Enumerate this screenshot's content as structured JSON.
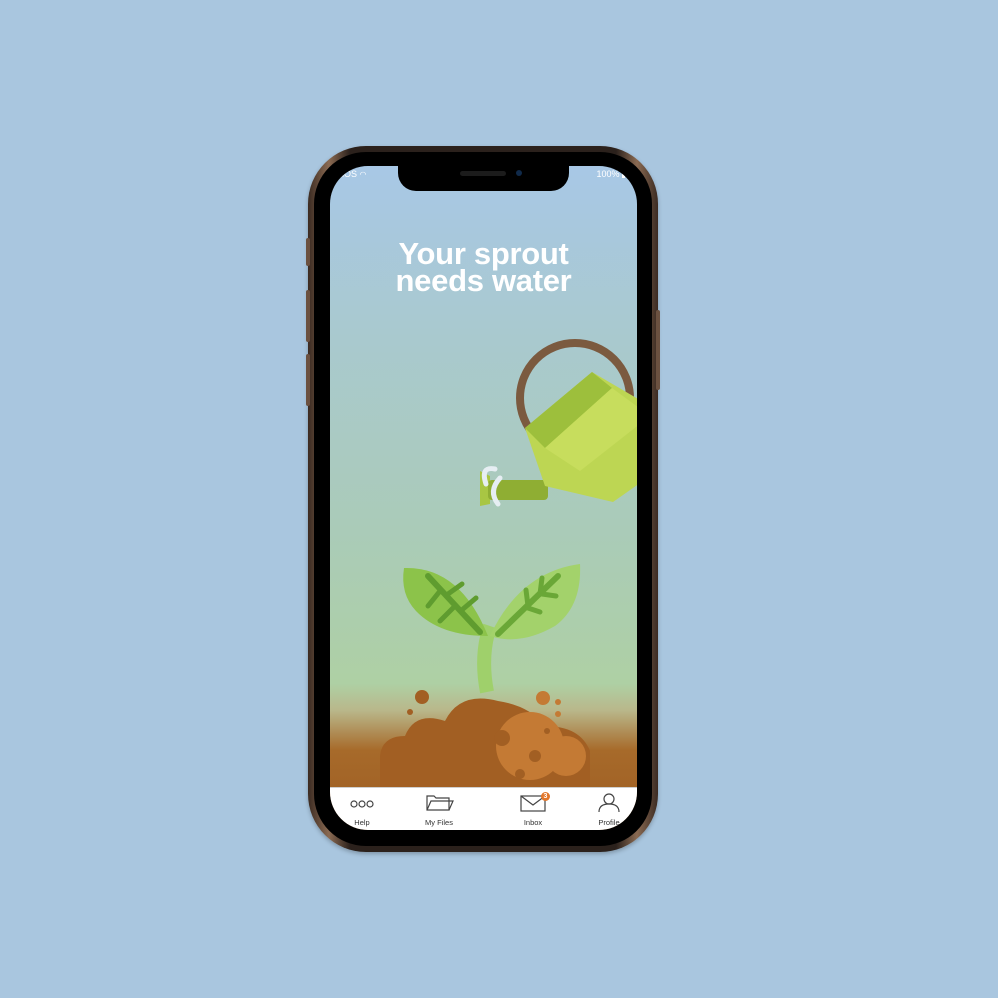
{
  "status_bar": {
    "carrier": "iOS",
    "battery": "100%"
  },
  "headline": {
    "line1": "Your sprout",
    "line2": "needs water"
  },
  "illustration": {
    "subject": "watering-can-and-sprout"
  },
  "tab_bar": {
    "tabs": [
      {
        "label": "Help",
        "icon": "more-dots-icon"
      },
      {
        "label": "My Files",
        "icon": "folder-icon"
      },
      {
        "label": "Inbox",
        "icon": "envelope-icon",
        "badge": "3"
      },
      {
        "label": "Profile",
        "icon": "person-icon"
      }
    ]
  },
  "colors": {
    "background": "#a9c6df",
    "sprout_green": "#8cc34a",
    "can_green": "#b8d554",
    "soil": "#a0601f",
    "badge": "#e2762a"
  }
}
